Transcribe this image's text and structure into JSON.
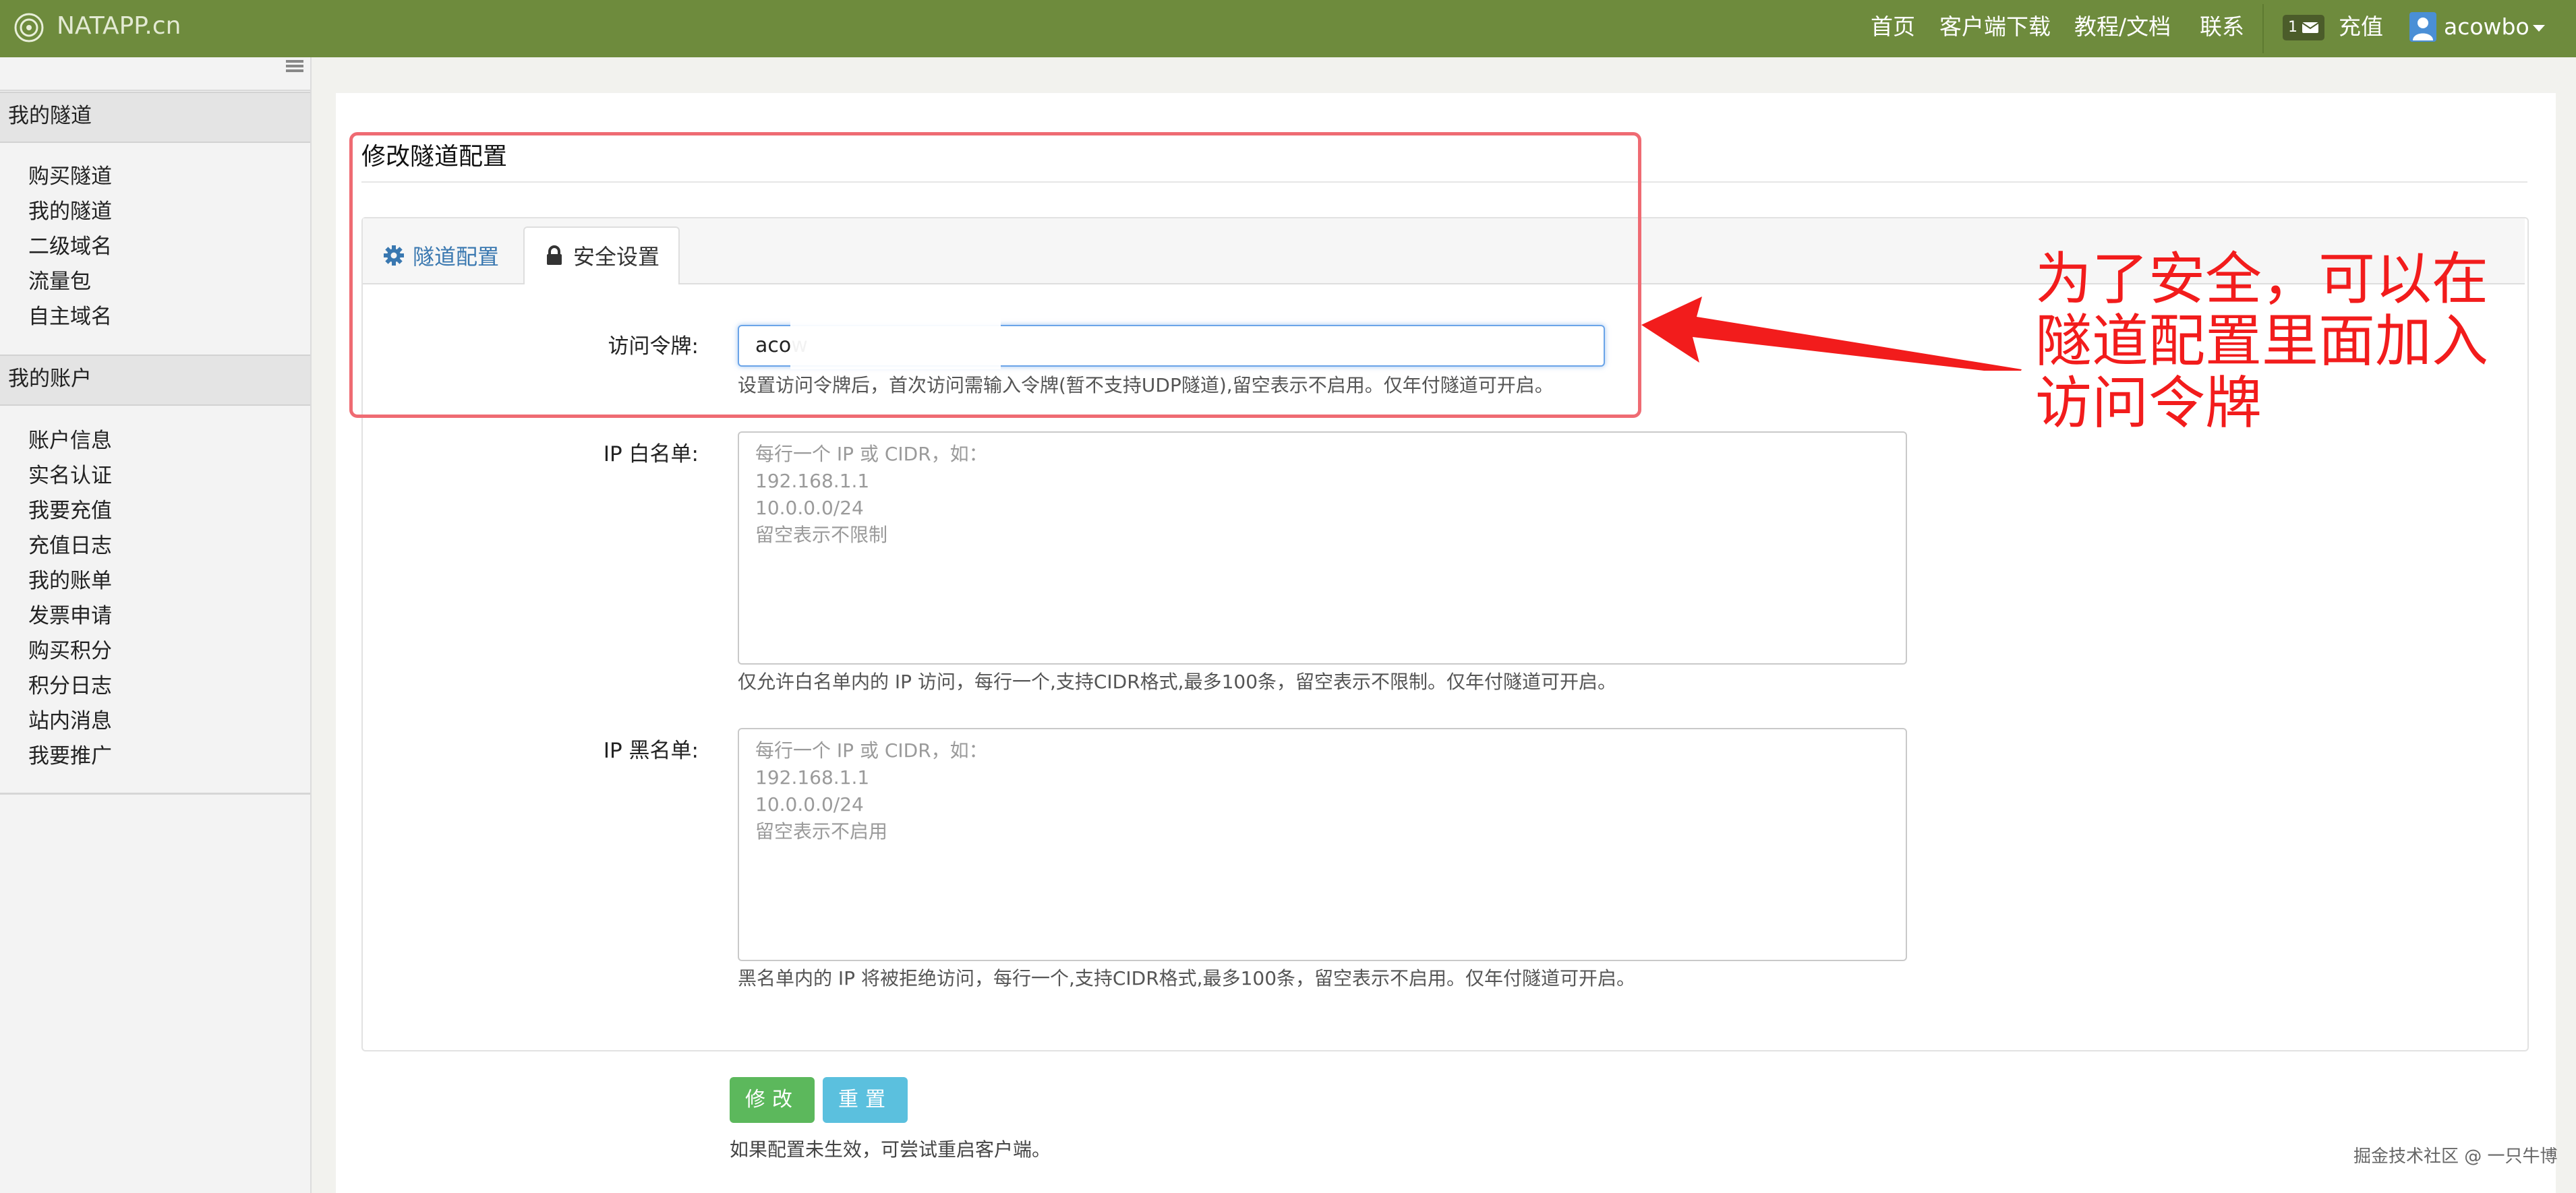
{
  "navbar": {
    "brand": "NATAPP.cn",
    "links": [
      "首页",
      "客户端下载",
      "教程/文档",
      "联系"
    ],
    "message_count": "1",
    "recharge": "充值",
    "username": "acowbo",
    "color": "#6e8b3d"
  },
  "sidebar": {
    "section1": {
      "title": "我的隧道",
      "items": [
        "购买隧道",
        "我的隧道",
        "二级域名",
        "流量包",
        "自主域名"
      ]
    },
    "section2": {
      "title": "我的账户",
      "items": [
        "账户信息",
        "实名认证",
        "我要充值",
        "充值日志",
        "我的账单",
        "发票申请",
        "购买积分",
        "积分日志",
        "站内消息",
        "我要推广"
      ]
    }
  },
  "main": {
    "title": "修改隧道配置",
    "tabs": [
      {
        "label": "隧道配置",
        "icon": "gear-icon",
        "active": false
      },
      {
        "label": "安全设置",
        "icon": "lock-icon",
        "active": true
      }
    ],
    "token": {
      "label": "访问令牌:",
      "value": "acow",
      "help": "设置访问令牌后，首次访问需输入令牌(暂不支持UDP隧道),留空表示不启用。仅年付隧道可开启。"
    },
    "whitelist": {
      "label": "IP 白名单:",
      "placeholder_lines": [
        "每行一个 IP 或 CIDR，如：",
        "192.168.1.1",
        "10.0.0.0/24",
        "留空表示不限制"
      ],
      "help": "仅允许白名单内的 IP 访问，每行一个,支持CIDR格式,最多100条，留空表示不限制。仅年付隧道可开启。"
    },
    "blacklist": {
      "label": "IP 黑名单:",
      "placeholder_lines": [
        "每行一个 IP 或 CIDR，如：",
        "192.168.1.1",
        "10.0.0.0/24",
        "留空表示不启用"
      ],
      "help": "黑名单内的 IP 将被拒绝访问，每行一个,支持CIDR格式,最多100条，留空表示不启用。仅年付隧道可开启。"
    },
    "buttons": {
      "submit": "修改",
      "reset": "重置"
    },
    "footnote": "如果配置未生效，可尝试重启客户端。"
  },
  "annotation": {
    "lines": [
      "为了安全，可以在",
      "隧道配置里面加入",
      "访问令牌"
    ],
    "color": "#f21c1c"
  },
  "watermark": "掘金技术社区 @ 一只牛博"
}
